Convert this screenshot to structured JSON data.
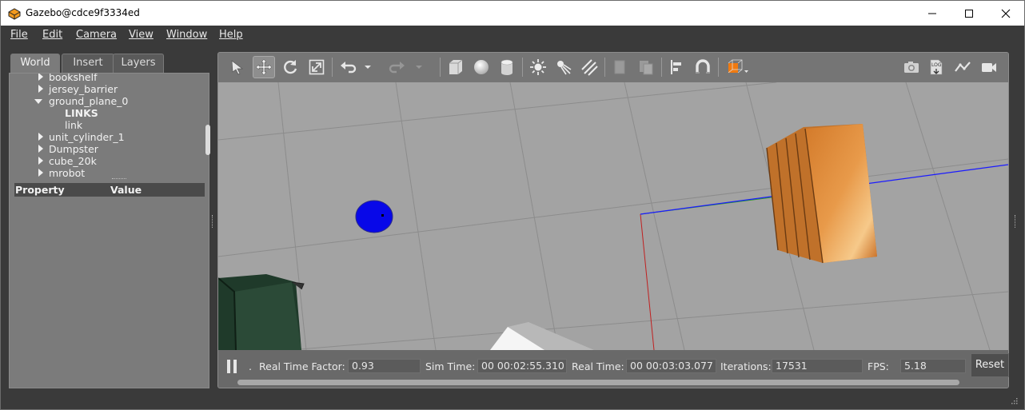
{
  "window": {
    "title": "Gazebo@cdce9f3334ed"
  },
  "menu": [
    "File",
    "Edit",
    "Camera",
    "View",
    "Window",
    "Help"
  ],
  "left_panel": {
    "tabs": [
      "World",
      "Insert",
      "Layers"
    ],
    "active_tab": "World",
    "tree": [
      {
        "label": "bookshelf",
        "level": 1,
        "expander": "collapsed"
      },
      {
        "label": "jersey_barrier",
        "level": 1,
        "expander": "collapsed"
      },
      {
        "label": "ground_plane_0",
        "level": 1,
        "expander": "expanded"
      },
      {
        "label": "LINKS",
        "level": 2,
        "expander": "none"
      },
      {
        "label": "link",
        "level": 2,
        "expander": "none"
      },
      {
        "label": "unit_cylinder_1",
        "level": 1,
        "expander": "collapsed"
      },
      {
        "label": "Dumpster",
        "level": 1,
        "expander": "collapsed"
      },
      {
        "label": "cube_20k",
        "level": 1,
        "expander": "collapsed"
      },
      {
        "label": "mrobot",
        "level": 1,
        "expander": "collapsed"
      }
    ],
    "property_header": {
      "property": "Property",
      "value": "Value"
    }
  },
  "toolbar": {
    "tools": [
      "select-arrow",
      "translate",
      "rotate",
      "scale",
      "undo",
      "undo-history",
      "redo",
      "redo-history",
      "box",
      "sphere",
      "cylinder",
      "point-light",
      "spot-light",
      "directional-light",
      "copy",
      "paste",
      "align",
      "snap",
      "view-angle"
    ],
    "right_tools": [
      "screenshot",
      "log",
      "plot",
      "video-record"
    ],
    "selected_tool": "translate",
    "colors": {
      "view_angle_cube": "#f07a10"
    }
  },
  "status": {
    "real_time_factor_label": "Real Time Factor:",
    "real_time_factor": "0.93",
    "sim_time_label": "Sim Time:",
    "sim_time": "00 00:02:55.310",
    "real_time_label": "Real Time:",
    "real_time": "00 00:03:03.077",
    "iterations_label": "Iterations:",
    "iterations": "17531",
    "fps_label": "FPS:",
    "fps": "5.18",
    "reset_label": "Reset",
    "step_label": "."
  }
}
